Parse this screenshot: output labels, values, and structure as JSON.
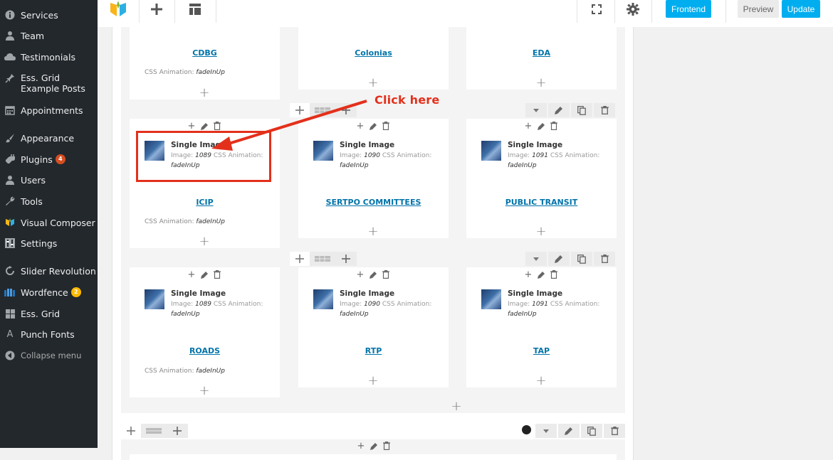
{
  "sidebar": {
    "items": [
      {
        "label": "Services",
        "icon": "info-icon"
      },
      {
        "label": "Team",
        "icon": "person-icon"
      },
      {
        "label": "Testimonials",
        "icon": "cloud-icon"
      },
      {
        "label": "Ess. Grid Example Posts",
        "icon": "pin-icon"
      },
      {
        "label": "Appointments",
        "icon": "calendar-icon"
      },
      {
        "label": "Appearance",
        "icon": "paintbrush-icon"
      },
      {
        "label": "Plugins",
        "icon": "plug-icon",
        "badge": "4"
      },
      {
        "label": "Users",
        "icon": "person-icon"
      },
      {
        "label": "Tools",
        "icon": "wrench-icon"
      },
      {
        "label": "Visual Composer",
        "icon": "vc-logo-icon"
      },
      {
        "label": "Settings",
        "icon": "settings-icon"
      },
      {
        "label": "Slider Revolution",
        "icon": "refresh-icon"
      },
      {
        "label": "Wordfence",
        "icon": "wordfence-icon",
        "badge": "2"
      },
      {
        "label": "Ess. Grid",
        "icon": "grid-icon"
      },
      {
        "label": "Punch Fonts",
        "icon": "font-a-icon"
      },
      {
        "label": "Collapse menu",
        "icon": "collapse-icon"
      }
    ]
  },
  "toolbar": {
    "frontend_label": "Frontend",
    "preview_label": "Preview",
    "update_label": "Update"
  },
  "row_top": {
    "columns": [
      {
        "title": "CDBG",
        "anim_label": "CSS Animation:",
        "anim_value": "fadeInUp"
      },
      {
        "title": "Colonias"
      },
      {
        "title": "EDA"
      }
    ]
  },
  "row_middle": {
    "columns": [
      {
        "img_title": "Single Image",
        "img_label": "Image:",
        "img_id": "1089",
        "anim_label": "CSS Animation:",
        "anim_value": "fadeInUp",
        "title": "ICIP",
        "col_anim_label": "CSS Animation:",
        "col_anim_value": "fadeInUp"
      },
      {
        "img_title": "Single Image",
        "img_label": "Image:",
        "img_id": "1090",
        "anim_label": "CSS Animation:",
        "anim_value": "fadeInUp",
        "title": "SERTPO COMMITTEES"
      },
      {
        "img_title": "Single Image",
        "img_label": "Image:",
        "img_id": "1091",
        "anim_label": "CSS Animation:",
        "anim_value": "fadeInUp",
        "title": "PUBLIC TRANSIT"
      }
    ]
  },
  "row_bottom": {
    "columns": [
      {
        "img_title": "Single Image",
        "img_label": "Image:",
        "img_id": "1089",
        "anim_label": "CSS Animation:",
        "anim_value": "fadeInUp",
        "title": "ROADS",
        "col_anim_label": "CSS Animation:",
        "col_anim_value": "fadeInUp"
      },
      {
        "img_title": "Single Image",
        "img_label": "Image:",
        "img_id": "1090",
        "anim_label": "CSS Animation:",
        "anim_value": "fadeInUp",
        "title": "RTP"
      },
      {
        "img_title": "Single Image",
        "img_label": "Image:",
        "img_id": "1091",
        "anim_label": "CSS Animation:",
        "anim_value": "fadeInUp",
        "title": "TAP"
      }
    ]
  },
  "annotation": {
    "text": "Click here",
    "color": "#e3301b"
  },
  "colors": {
    "sidebar_bg": "#23282d",
    "accent_blue": "#00aeef",
    "link_blue": "#0073aa"
  }
}
